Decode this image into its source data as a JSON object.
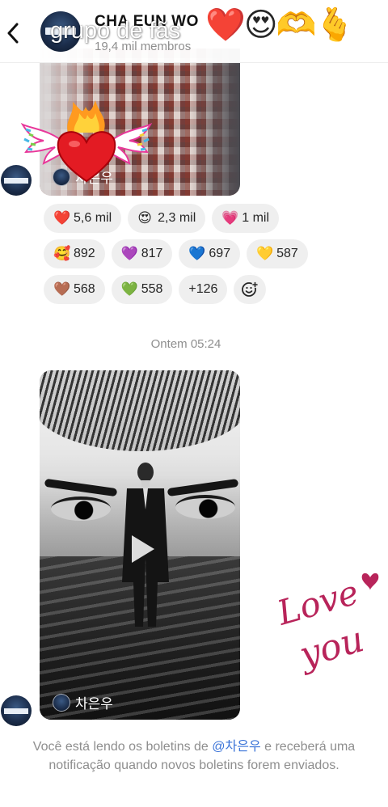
{
  "header": {
    "channel_name": "CHA EUN WO",
    "subtitle": "19,4 mil membros",
    "back_icon": "chevron-left-icon"
  },
  "story_overlay": {
    "caption": "grupo de fãs",
    "emojis": [
      "❤️",
      "😍",
      "🫶",
      "🫰"
    ]
  },
  "posts": [
    {
      "author_label": "차은우",
      "reactions": [
        [
          {
            "emoji": "❤️",
            "count": "5,6 mil"
          },
          {
            "emoji": "😍",
            "count": "2,3 mil"
          },
          {
            "emoji": "💗",
            "count": "1 mil"
          }
        ],
        [
          {
            "emoji": "🥰",
            "count": "892"
          },
          {
            "emoji": "💜",
            "count": "817"
          },
          {
            "emoji": "💙",
            "count": "697"
          },
          {
            "emoji": "💛",
            "count": "587"
          }
        ],
        [
          {
            "emoji": "🤎",
            "count": "568"
          },
          {
            "emoji": "💚",
            "count": "558"
          },
          {
            "emoji": "",
            "count": "+126"
          }
        ]
      ],
      "add_reaction_icon": "add-reaction-icon"
    },
    {
      "author_label": "차은우",
      "media_type": "video"
    }
  ],
  "timestamp": "Ontem 05:24",
  "stickers": {
    "love_line1": "Love",
    "love_line2": "you"
  },
  "footer": {
    "text_before": "Você está lendo os boletins de ",
    "mention": "@차은우",
    "text_after": " e receberá uma notificação quando novos boletins forem enviados."
  },
  "colors": {
    "accent": "#3b74d8",
    "chip_bg": "#efefef",
    "muted_text": "#8e8e8e",
    "love_sticker": "#b8245a"
  }
}
